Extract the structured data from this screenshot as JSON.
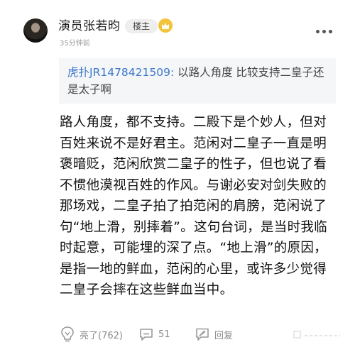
{
  "post": {
    "author": "演员张若昀",
    "badge": "楼主",
    "timestamp": "35分钟前",
    "quote": {
      "author": "虎扑JR1478421509:",
      "text": " 以路人角度 比较支持二皇子还是太子啊"
    },
    "body": "路人角度，都不支持。二殿下是个妙人，但对百姓来说不是好君主。范闲对二皇子一直是明褒暗贬，范闲欣赏二皇子的性子，但也说了看不惯他漠视百姓的作风。与谢必安对剑失败的那场戏，二皇子拍了拍范闲的肩膀，范闲说了句“地上滑，别摔着”。这句台词，是当时我临时起意，可能埋的深了点。“地上滑”的原因，是指一地的鲜血，范闲的心里，或许多少觉得二皇子会摔在这些鲜血当中。"
  },
  "actions": {
    "like_label": "亮了(762)",
    "comment_count": "51",
    "reply_label": "回复"
  },
  "icons": {
    "crown": "crown-icon",
    "more": "more-icon",
    "like": "lightbulb-icon",
    "comment": "comment-icon",
    "reply": "reply-icon"
  },
  "colors": {
    "link_blue": "#3b78c9",
    "crown_yellow": "#f3c33b",
    "muted_gray": "#8a8a8a",
    "quote_bg": "#f5f6f8"
  }
}
